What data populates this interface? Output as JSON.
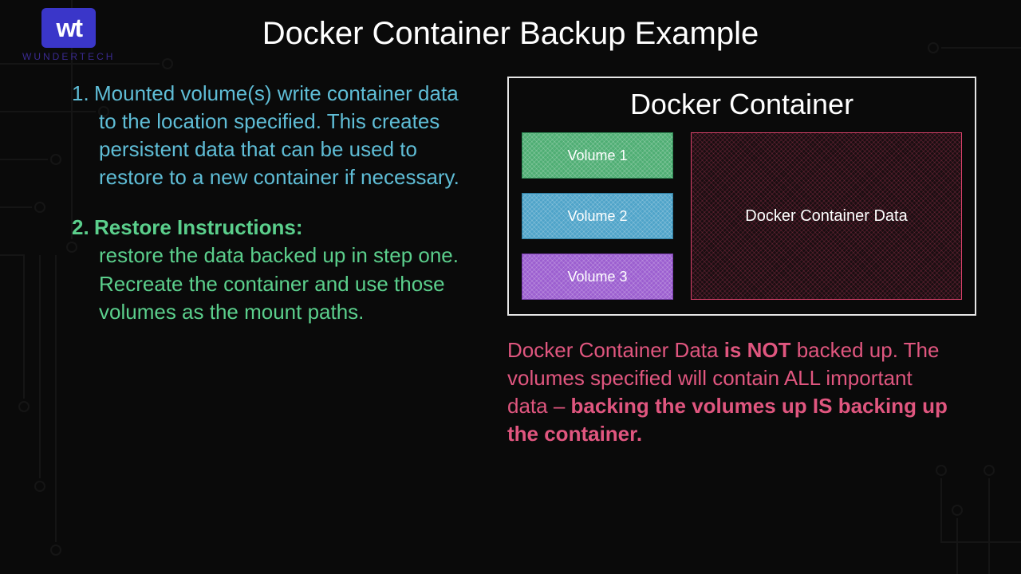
{
  "logo": {
    "mark": "wt",
    "brand": "WUNDERTECH"
  },
  "title": "Docker Container Backup Example",
  "steps": [
    {
      "num": "1.",
      "heading": "",
      "body": "Mounted volume(s) write container data to the location specified. This creates persistent data that can be used to restore to a new container if necessary."
    },
    {
      "num": "2.",
      "heading": "Restore Instructions:",
      "body": "restore the data backed up in step one. Recreate the container and use those volumes as the mount paths."
    }
  ],
  "diagram": {
    "container_title": "Docker Container",
    "volumes": [
      "Volume 1",
      "Volume 2",
      "Volume 3"
    ],
    "data_label": "Docker Container Data"
  },
  "note": {
    "p1a": "Docker Container Data ",
    "p1b": "is NOT",
    "p2": " backed up. The volumes specified will contain ALL important data – ",
    "p3": "backing the volumes up IS backing up the container."
  },
  "colors": {
    "step1": "#5fbdd6",
    "step2": "#5bcf8c",
    "note": "#e0567f",
    "vol1": "#4fae74",
    "vol2": "#4fa4c9",
    "vol3": "#9c5fd0"
  }
}
